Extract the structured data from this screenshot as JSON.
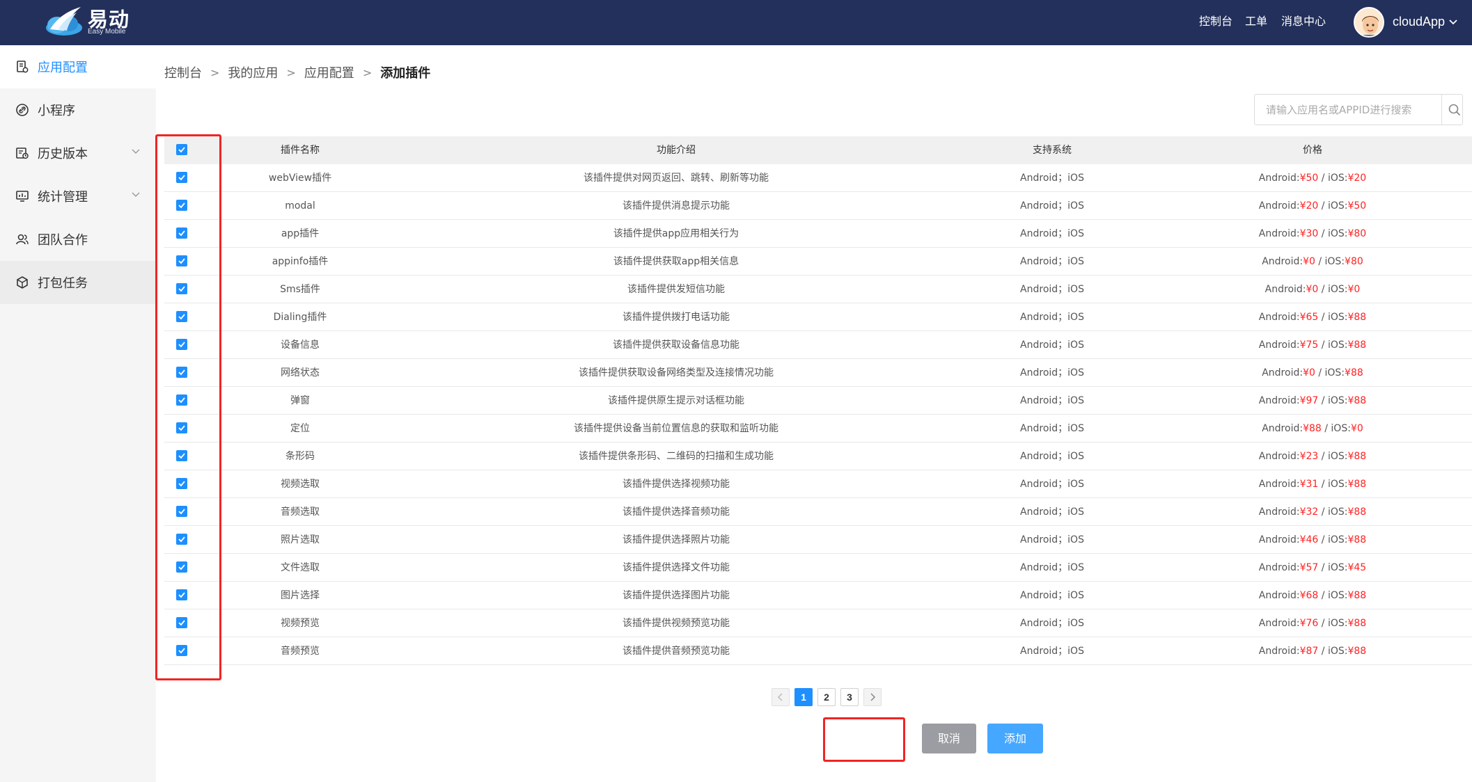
{
  "brand": {
    "name": "易动",
    "subtitle": "Easy Mobile",
    "logo_icon": "cloud-bird-logo"
  },
  "topnav": {
    "items": [
      "控制台",
      "工单",
      "消息中心"
    ]
  },
  "user": {
    "name": "cloudApp",
    "avatar_icon": "avatar"
  },
  "sidebar": {
    "items": [
      {
        "label": "应用配置",
        "icon": "doc-settings-icon",
        "active": true
      },
      {
        "label": "小程序",
        "icon": "link-icon"
      },
      {
        "label": "历史版本",
        "icon": "history-icon",
        "expandable": true
      },
      {
        "label": "统计管理",
        "icon": "chart-monitor-icon",
        "expandable": true
      },
      {
        "label": "团队合作",
        "icon": "team-icon"
      },
      {
        "label": "打包任务",
        "icon": "package-icon"
      }
    ]
  },
  "breadcrumb": {
    "items": [
      "控制台",
      "我的应用",
      "应用配置"
    ],
    "current": "添加插件"
  },
  "search": {
    "placeholder": "请输入应用名或APPID进行搜索"
  },
  "table": {
    "columns": [
      "插件名称",
      "功能介绍",
      "支持系统",
      "价格"
    ],
    "rows": [
      {
        "name": "webView插件",
        "desc": "该插件提供对网页返回、跳转、刷新等功能",
        "os": "Android；iOS",
        "android_label": "Android:",
        "android_price": "¥50",
        "sep": "/",
        "ios_label": "iOS:",
        "ios_price": "¥20"
      },
      {
        "name": "modal",
        "desc": "该插件提供消息提示功能",
        "os": "Android；iOS",
        "android_label": "Android:",
        "android_price": "¥20",
        "sep": "/",
        "ios_label": "iOS:",
        "ios_price": "¥50"
      },
      {
        "name": "app插件",
        "desc": "该插件提供app应用相关行为",
        "os": "Android；iOS",
        "android_label": "Android:",
        "android_price": "¥30",
        "sep": "/",
        "ios_label": "iOS:",
        "ios_price": "¥80"
      },
      {
        "name": "appinfo插件",
        "desc": "该插件提供获取app相关信息",
        "os": "Android；iOS",
        "android_label": "Android:",
        "android_price": "¥0",
        "sep": "/",
        "ios_label": "iOS:",
        "ios_price": "¥80"
      },
      {
        "name": "Sms插件",
        "desc": "该插件提供发短信功能",
        "os": "Android；iOS",
        "android_label": "Android:",
        "android_price": "¥0",
        "sep": "/",
        "ios_label": "iOS:",
        "ios_price": "¥0"
      },
      {
        "name": "Dialing插件",
        "desc": "该插件提供拨打电话功能",
        "os": "Android；iOS",
        "android_label": "Android:",
        "android_price": "¥65",
        "sep": "/",
        "ios_label": "iOS:",
        "ios_price": "¥88"
      },
      {
        "name": "设备信息",
        "desc": "该插件提供获取设备信息功能",
        "os": "Android；iOS",
        "android_label": "Android:",
        "android_price": "¥75",
        "sep": "/",
        "ios_label": "iOS:",
        "ios_price": "¥88"
      },
      {
        "name": "网络状态",
        "desc": "该插件提供获取设备网络类型及连接情况功能",
        "os": "Android；iOS",
        "android_label": "Android:",
        "android_price": "¥0",
        "sep": "/",
        "ios_label": "iOS:",
        "ios_price": "¥88"
      },
      {
        "name": "弹窗",
        "desc": "该插件提供原生提示对话框功能",
        "os": "Android；iOS",
        "android_label": "Android:",
        "android_price": "¥97",
        "sep": "/",
        "ios_label": "iOS:",
        "ios_price": "¥88"
      },
      {
        "name": "定位",
        "desc": "该插件提供设备当前位置信息的获取和监听功能",
        "os": "Android；iOS",
        "android_label": "Android:",
        "android_price": "¥88",
        "sep": "/",
        "ios_label": "iOS:",
        "ios_price": "¥0"
      },
      {
        "name": "条形码",
        "desc": "该插件提供条形码、二维码的扫描和生成功能",
        "os": "Android；iOS",
        "android_label": "Android:",
        "android_price": "¥23",
        "sep": "/",
        "ios_label": "iOS:",
        "ios_price": "¥88"
      },
      {
        "name": "视频选取",
        "desc": "该插件提供选择视频功能",
        "os": "Android；iOS",
        "android_label": "Android:",
        "android_price": "¥31",
        "sep": "/",
        "ios_label": "iOS:",
        "ios_price": "¥88"
      },
      {
        "name": "音频选取",
        "desc": "该插件提供选择音频功能",
        "os": "Android；iOS",
        "android_label": "Android:",
        "android_price": "¥32",
        "sep": "/",
        "ios_label": "iOS:",
        "ios_price": "¥88"
      },
      {
        "name": "照片选取",
        "desc": "该插件提供选择照片功能",
        "os": "Android；iOS",
        "android_label": "Android:",
        "android_price": "¥46",
        "sep": "/",
        "ios_label": "iOS:",
        "ios_price": "¥88"
      },
      {
        "name": "文件选取",
        "desc": "该插件提供选择文件功能",
        "os": "Android；iOS",
        "android_label": "Android:",
        "android_price": "¥57",
        "sep": "/",
        "ios_label": "iOS:",
        "ios_price": "¥45"
      },
      {
        "name": "图片选择",
        "desc": "该插件提供选择图片功能",
        "os": "Android；iOS",
        "android_label": "Android:",
        "android_price": "¥68",
        "sep": "/",
        "ios_label": "iOS:",
        "ios_price": "¥88"
      },
      {
        "name": "视频预览",
        "desc": "该插件提供视频预览功能",
        "os": "Android；iOS",
        "android_label": "Android:",
        "android_price": "¥76",
        "sep": "/",
        "ios_label": "iOS:",
        "ios_price": "¥88"
      },
      {
        "name": "音频预览",
        "desc": "该插件提供音频预览功能",
        "os": "Android；iOS",
        "android_label": "Android:",
        "android_price": "¥87",
        "sep": "/",
        "ios_label": "iOS:",
        "ios_price": "¥88"
      }
    ]
  },
  "pagination": {
    "pages": [
      "1",
      "2",
      "3"
    ],
    "current": "1",
    "prev_icon": "chevron-left-icon",
    "next_icon": "chevron-right-icon"
  },
  "actions": {
    "cancel_label": "取消",
    "add_label": "添加"
  },
  "colors": {
    "header": "#23305b",
    "accent": "#1e8fff",
    "price": "#ff2222",
    "highlight": "#f02424"
  }
}
